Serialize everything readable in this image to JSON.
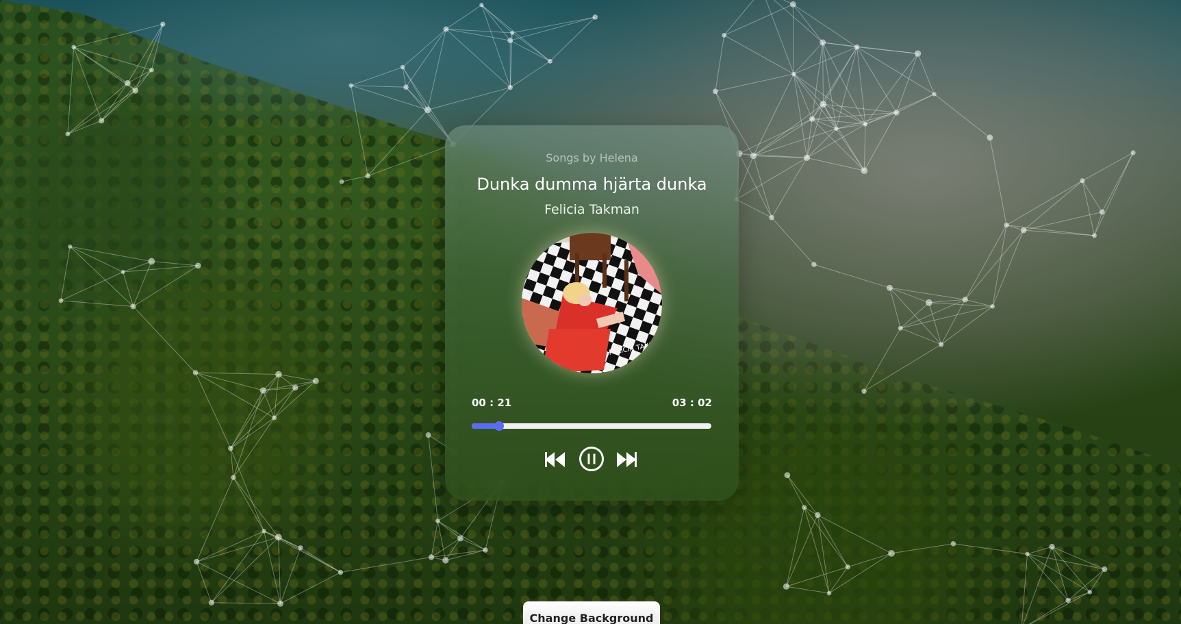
{
  "player": {
    "subtitle": "Songs by Helena",
    "song_title": "Dunka dumma hjärta dunka",
    "artist": "Felicia Takman",
    "cover_text": "FELICIA TAKMAN",
    "current_time": "00 : 21",
    "total_time": "03 : 02",
    "progress_fraction": 0.115,
    "accent_color": "#5b6cf0",
    "controls": {
      "prev_icon": "rewind-icon",
      "play_icon": "pause-icon",
      "next_icon": "fast-forward-icon"
    }
  },
  "footer": {
    "change_background_label": "Change Background"
  }
}
